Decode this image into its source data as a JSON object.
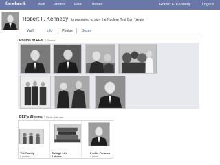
{
  "topbar": {
    "logo": "facebook",
    "nav": [
      "Wall",
      "Photos",
      "Flair",
      "Boxes"
    ],
    "user": "Robert F. Kennedy",
    "logout": "Logout"
  },
  "profile": {
    "name": "Robert F. Kennedy",
    "status": "is preparing to sign the Nuclear Test Ban Treaty"
  },
  "tabs": [
    "Wall",
    "Info",
    "Photos",
    "Boxes"
  ],
  "active_tab": "Photos",
  "photos_section": {
    "title": "Photos of RFK",
    "count": "7 Photos"
  },
  "albums_section": {
    "title": "RFK's Albums",
    "count": "3 Photo Albums"
  },
  "albums": [
    {
      "title": "The Family",
      "count": "6 photos"
    },
    {
      "title": "College Life",
      "count": "8 photos"
    },
    {
      "title": "Profile Pictures",
      "count": "1 photo"
    }
  ],
  "colors": {
    "topbar": "#6a78a8",
    "link": "#3b5998",
    "panel": "#e7e9ee"
  }
}
